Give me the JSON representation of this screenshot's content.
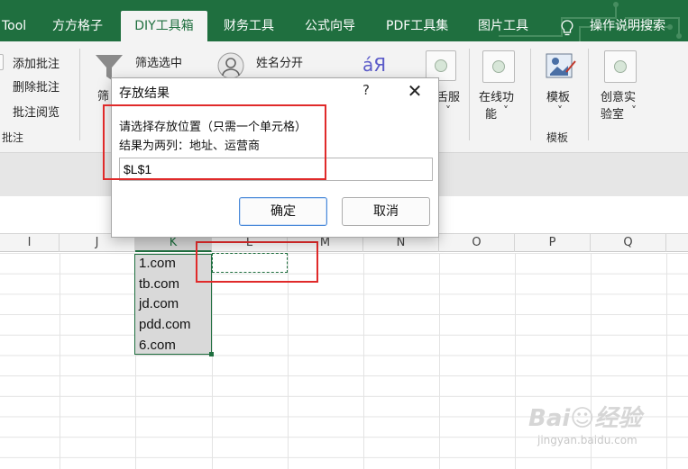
{
  "tabs": [
    {
      "label": "Tool"
    },
    {
      "label": "方方格子"
    },
    {
      "label": "DIY工具箱"
    },
    {
      "label": "财务工具"
    },
    {
      "label": "公式向导"
    },
    {
      "label": "PDF工具集"
    },
    {
      "label": "图片工具"
    },
    {
      "label": "操作说明搜索"
    }
  ],
  "ribbon": {
    "comment_group": {
      "add": "添加批注",
      "delete": "删除批注",
      "review": "批注阅览",
      "group_label": "批注"
    },
    "filter": {
      "selected": "筛选选中",
      "partial": "筛"
    },
    "name_split": "姓名分开",
    "lang_icon_text": "áЯ",
    "button_partial": "舌服",
    "chev": "˅",
    "online": {
      "line1": "在线功",
      "line2": "能"
    },
    "template": {
      "label": "模板",
      "group_label": "模板"
    },
    "lab": {
      "line1": "创意实",
      "line2": "验室"
    }
  },
  "columns": [
    "I",
    "J",
    "K",
    "L",
    "M",
    "N",
    "O",
    "P",
    "Q"
  ],
  "cells": [
    "1.com",
    "tb.com",
    "jd.com",
    "pdd.com",
    "6.com"
  ],
  "dialog": {
    "title": "存放结果",
    "help": "?",
    "close": "✕",
    "prompt": "请选择存放位置（只需一个单元格）",
    "prompt2": "结果为两列：地址、运营商",
    "value": "$L$1",
    "ok": "确定",
    "cancel": "取消"
  },
  "watermark": {
    "logo": "Bai☺经验",
    "url": "jingyan.baidu.com"
  },
  "colors": {
    "excel_green": "#1f6f3f",
    "highlight_red": "#e02a2a"
  }
}
